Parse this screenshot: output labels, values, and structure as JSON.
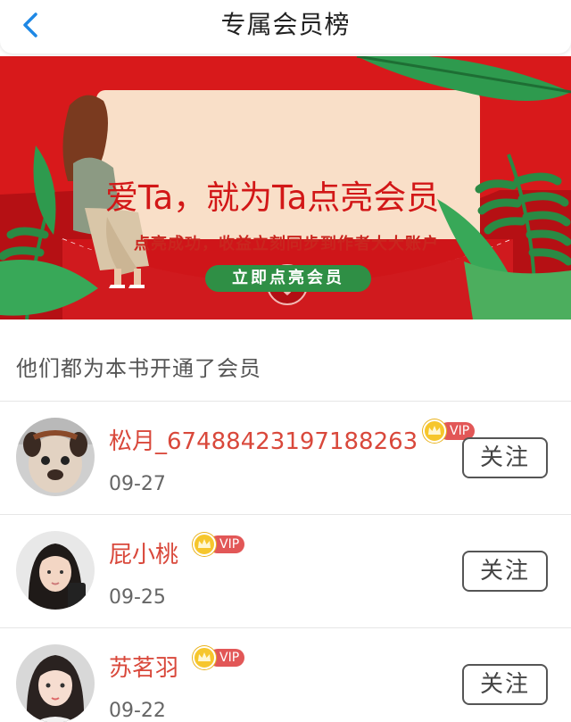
{
  "header": {
    "title": "专属会员榜",
    "back_icon": "chevron-left-icon"
  },
  "banner": {
    "headline": "爱Ta，就为Ta点亮会员",
    "subline": "点亮成功，收益立刻同步到作者大大账户",
    "cta_label": "立即点亮会员",
    "colors": {
      "background": "#d8191b",
      "card": "#f9dfc8",
      "cta": "#2f8f45",
      "leaf": "#2e9a4e"
    }
  },
  "section": {
    "title": "他们都为本书开通了会员"
  },
  "members": [
    {
      "name": "松月_67488423197188263",
      "date": "09-27",
      "badge": "VIP",
      "follow_label": "关注",
      "avatar_icon": "dog-avatar"
    },
    {
      "name": "屁小桃",
      "date": "09-25",
      "badge": "VIP",
      "follow_label": "关注",
      "avatar_icon": "girl-avatar"
    },
    {
      "name": "苏茗羽",
      "date": "09-22",
      "badge": "VIP",
      "follow_label": "关注",
      "avatar_icon": "girl-avatar"
    }
  ],
  "colors": {
    "name": "#d9483b",
    "vip_badge": "#e25757",
    "crown": "#f6c62c"
  }
}
